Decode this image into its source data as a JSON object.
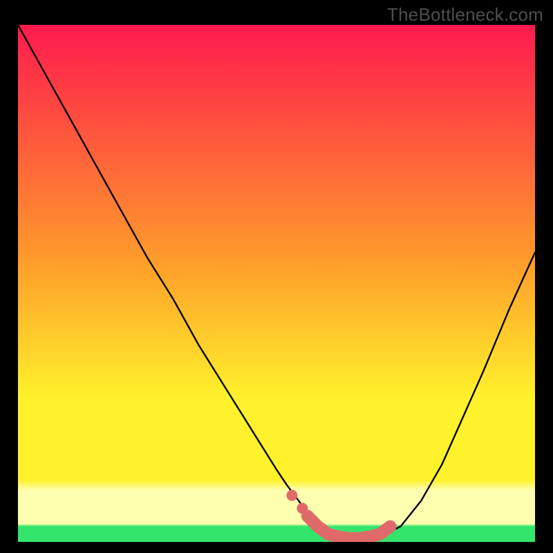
{
  "watermark": "TheBottleneck.com",
  "colors": {
    "background": "#000000",
    "watermark": "#4e4e4e",
    "curve": "#000000",
    "marker": "#e06a6a",
    "grad_top": "#ff1a4e",
    "grad_mid1": "#ff9a2b",
    "grad_mid2": "#fff12b",
    "grad_band": "#ffffb0",
    "grad_bottom": "#34e56b"
  },
  "chart_data": {
    "type": "line",
    "title": "",
    "xlabel": "",
    "ylabel": "",
    "xlim": [
      0,
      100
    ],
    "ylim": [
      0,
      100
    ],
    "series": [
      {
        "name": "bottleneck-curve",
        "x": [
          0,
          5,
          10,
          15,
          20,
          25,
          30,
          35,
          40,
          45,
          50,
          52,
          55,
          58,
          60,
          62,
          65,
          68,
          70,
          74,
          78,
          82,
          86,
          90,
          95,
          100
        ],
        "y": [
          100,
          91,
          82,
          73,
          64,
          55,
          47,
          38,
          30,
          22,
          14,
          11,
          7,
          4,
          2,
          1,
          0.5,
          0.5,
          1,
          3,
          8,
          15,
          24,
          33,
          45,
          56
        ]
      }
    ],
    "markers": {
      "name": "optimal-range",
      "x": [
        56,
        58,
        60,
        62,
        64,
        66,
        68,
        70,
        72
      ],
      "y": [
        5,
        3,
        1.5,
        1,
        0.7,
        0.7,
        1,
        1.5,
        3
      ]
    }
  }
}
